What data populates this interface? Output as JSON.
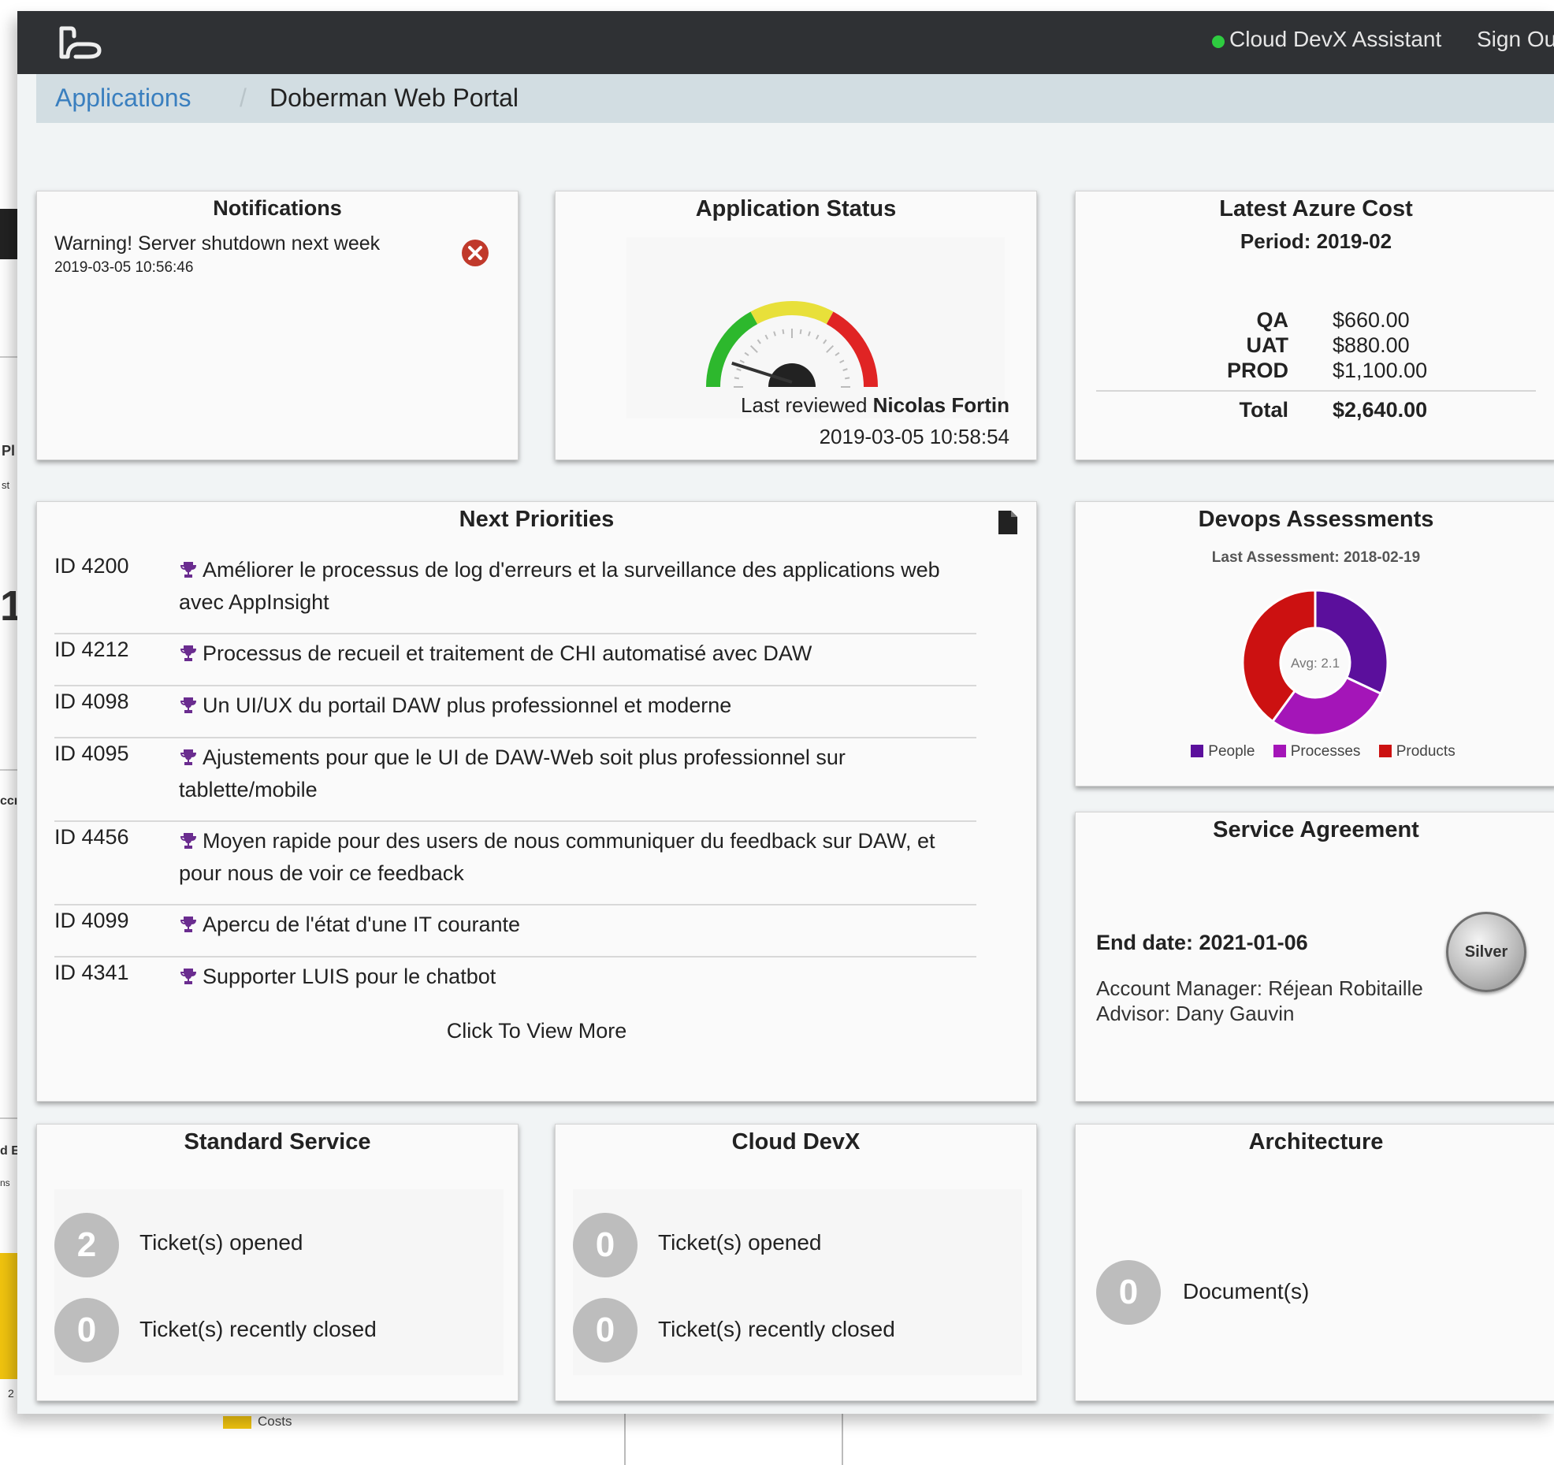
{
  "app": {
    "assistant_label": "Cloud DevX Assistant",
    "signout_label": "Sign Ou",
    "status_color": "#2ecc40"
  },
  "breadcrumb": {
    "parent": "Applications",
    "separator": "/",
    "current": "Doberman Web Portal"
  },
  "background_window": {
    "fragments": [
      "Pl",
      "st",
      "1",
      "ccı",
      "d E",
      "ns",
      "2"
    ],
    "legend_label": "Costs"
  },
  "notifications": {
    "title": "Notifications",
    "items": [
      {
        "message": "Warning! Server shutdown next week",
        "time": "2019-03-05 10:56:46"
      }
    ],
    "close_icon": "close-circle-icon"
  },
  "app_status": {
    "title": "Application Status",
    "gauge_value_fraction": 0.12,
    "gauge_colors": [
      "#2db82d",
      "#e8e03a",
      "#e02424"
    ],
    "reviewed_prefix": "Last reviewed",
    "reviewer": "Nicolas Fortin",
    "reviewed_time": "2019-03-05 10:58:54"
  },
  "azure_cost": {
    "title": "Latest Azure Cost",
    "period": "Period: 2019-02",
    "rows": [
      {
        "label": "QA",
        "value": "$660.00"
      },
      {
        "label": "UAT",
        "value": "$880.00"
      },
      {
        "label": "PROD",
        "value": "$1,100.00"
      }
    ],
    "total_label": "Total",
    "total_value": "$2,640.00"
  },
  "priorities": {
    "title": "Next Priorities",
    "export_icon": "document-icon",
    "items": [
      {
        "id": "ID 4200",
        "text": "Améliorer le processus de log d'erreurs et la surveillance des applications web avec AppInsight"
      },
      {
        "id": "ID 4212",
        "text": "Processus de recueil et traitement de CHI automatisé avec DAW"
      },
      {
        "id": "ID 4098",
        "text": "Un UI/UX du portail DAW plus professionnel et moderne"
      },
      {
        "id": "ID 4095",
        "text": "Ajustements pour que le UI de DAW-Web soit plus professionnel sur tablette/mobile"
      },
      {
        "id": "ID 4456",
        "text": "Moyen rapide pour des users de nous communiquer du feedback sur DAW, et pour nous de voir ce feedback"
      },
      {
        "id": "ID 4099",
        "text": "Apercu de l'état d'une IT courante"
      },
      {
        "id": "ID 4341",
        "text": "Supporter LUIS pour le chatbot"
      }
    ],
    "view_more": "Click To View More",
    "trophy_color": "#6a2c8f"
  },
  "devops": {
    "title": "Devops Assessments",
    "last_assessment": "Last Assessment: 2018-02-19",
    "avg_label": "Avg: 2.1",
    "segments": [
      {
        "name": "People",
        "share": 0.32,
        "color": "#5b0f9c"
      },
      {
        "name": "Processes",
        "share": 0.28,
        "color": "#a415b8"
      },
      {
        "name": "Products",
        "share": 0.4,
        "color": "#cc1111"
      }
    ]
  },
  "service_agreement": {
    "title": "Service Agreement",
    "end_date": "End date: 2021-01-06",
    "account_manager": "Account Manager: Réjean Robitaille",
    "advisor": "Advisor: Dany Gauvin",
    "tier": "Silver"
  },
  "standard_service": {
    "title": "Standard Service",
    "opened_count": "2",
    "opened_label": "Ticket(s) opened",
    "closed_count": "0",
    "closed_label": "Ticket(s) recently closed"
  },
  "cloud_devx": {
    "title": "Cloud DevX",
    "opened_count": "0",
    "opened_label": "Ticket(s) opened",
    "closed_count": "0",
    "closed_label": "Ticket(s) recently closed"
  },
  "architecture": {
    "title": "Architecture",
    "doc_count": "0",
    "doc_label": "Document(s)"
  }
}
